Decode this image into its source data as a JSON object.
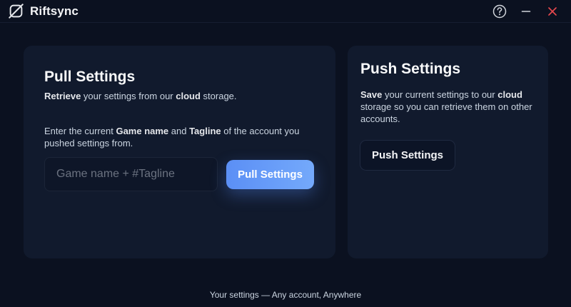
{
  "app": {
    "title": "Riftsync"
  },
  "window_controls": {
    "help_icon": "help-circle-icon",
    "minimize_icon": "minimize-icon",
    "close_icon": "close-icon",
    "close_color": "#e5484d"
  },
  "pull": {
    "title": "Pull Settings",
    "subtitle": {
      "bold1": "Retrieve",
      "text1": " your settings from our ",
      "bold2": "cloud",
      "text2": " storage."
    },
    "instruction": {
      "text1": "Enter the current ",
      "bold1": "Game name",
      "text2": " and ",
      "bold2": "Tagline",
      "text3": " of the account you pushed settings from."
    },
    "input": {
      "placeholder": "Game name + #Tagline",
      "value": ""
    },
    "button_label": "Pull Settings"
  },
  "push": {
    "title": "Push Settings",
    "description": {
      "bold1": "Save",
      "text1": " your current settings to our ",
      "bold2": "cloud",
      "text2": " storage so you can retrieve them on other accounts."
    },
    "button_label": "Push Settings"
  },
  "footer": {
    "text": "Your settings — Any account, Anywhere"
  },
  "colors": {
    "background": "#0b1120",
    "card": "#111a2d",
    "accent_start": "#5b8ff5",
    "accent_end": "#74a9fb"
  }
}
